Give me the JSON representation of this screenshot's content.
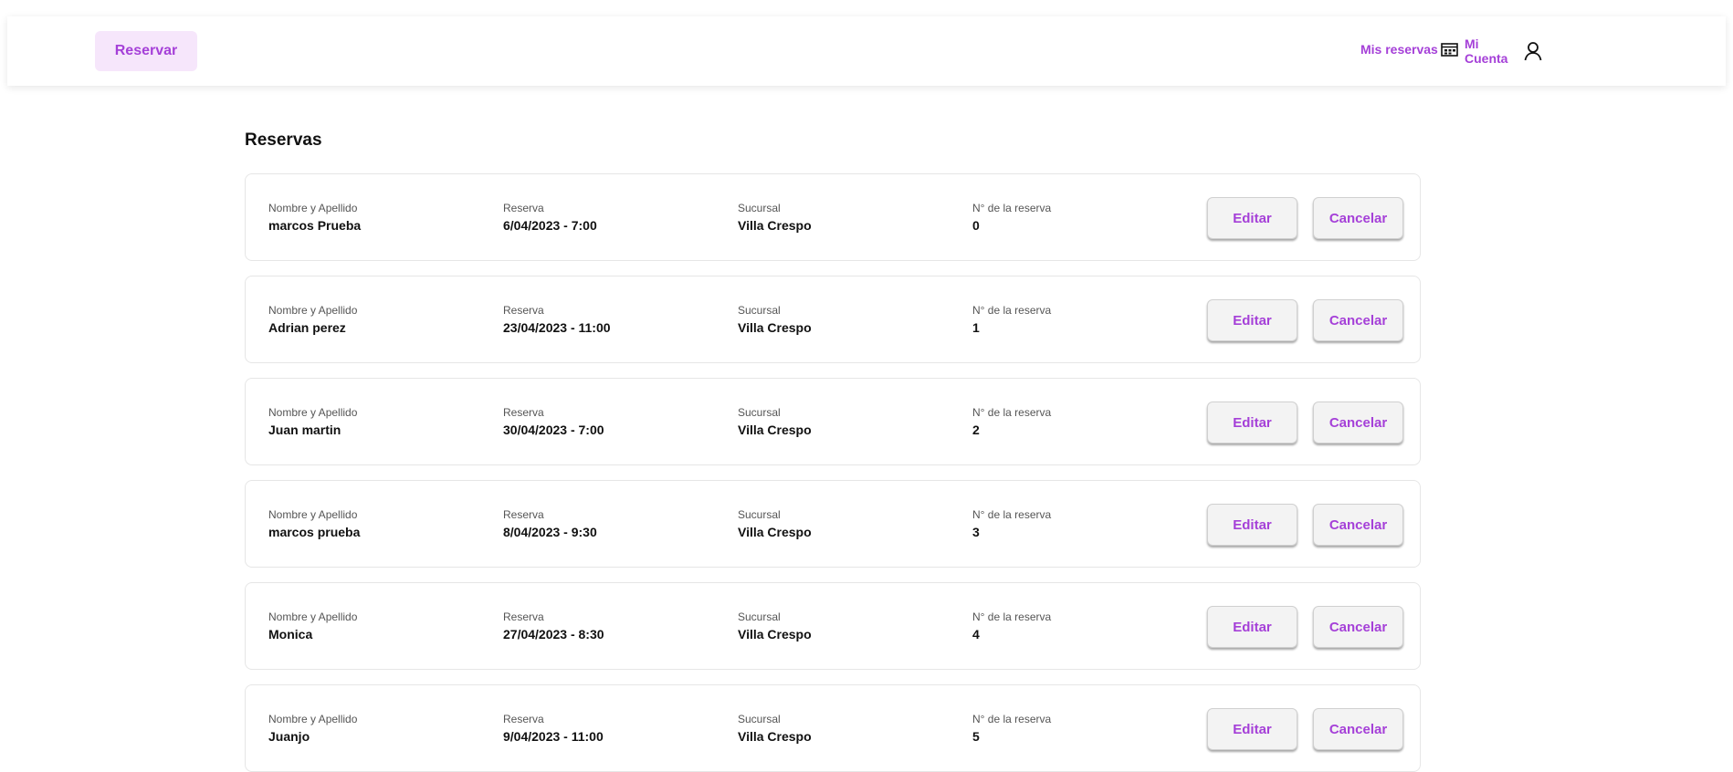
{
  "navbar": {
    "reservar_label": "Reservar",
    "mis_reservas_label": "Mis reservas",
    "mi_cuenta_label_1": "Mi",
    "mi_cuenta_label_2": "Cuenta",
    "accent_color": "#a540d8"
  },
  "page": {
    "title": "Reservas"
  },
  "labels": {
    "nombre": "Nombre y Apellido",
    "reserva": "Reserva",
    "sucursal": "Sucursal",
    "numero": "N° de la reserva",
    "editar": "Editar",
    "cancelar": "Cancelar"
  },
  "reservas": [
    {
      "nombre": "marcos Prueba",
      "reserva": "6/04/2023 - 7:00",
      "sucursal": "Villa Crespo",
      "numero": "0"
    },
    {
      "nombre": "Adrian perez",
      "reserva": "23/04/2023 - 11:00",
      "sucursal": "Villa Crespo",
      "numero": "1"
    },
    {
      "nombre": "Juan martin",
      "reserva": "30/04/2023 - 7:00",
      "sucursal": "Villa Crespo",
      "numero": "2"
    },
    {
      "nombre": "marcos prueba",
      "reserva": "8/04/2023 - 9:30",
      "sucursal": "Villa Crespo",
      "numero": "3"
    },
    {
      "nombre": "Monica",
      "reserva": "27/04/2023 - 8:30",
      "sucursal": "Villa Crespo",
      "numero": "4"
    },
    {
      "nombre": "Juanjo",
      "reserva": "9/04/2023 - 11:00",
      "sucursal": "Villa Crespo",
      "numero": "5"
    }
  ]
}
